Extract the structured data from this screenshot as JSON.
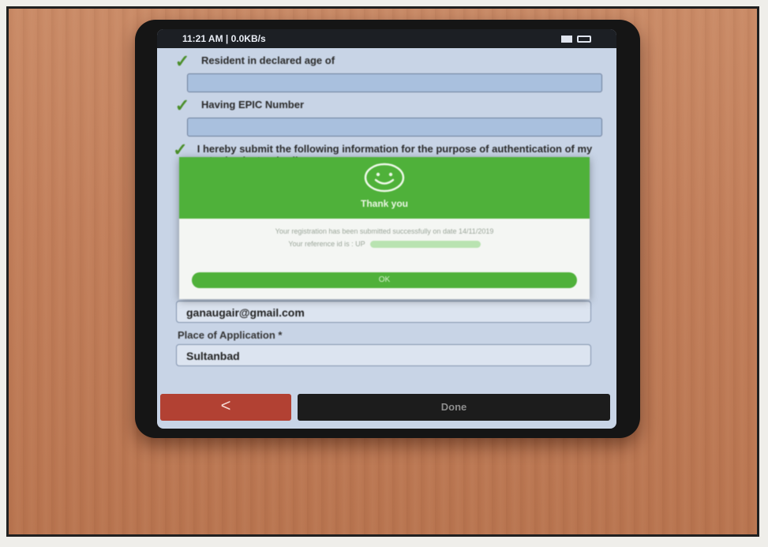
{
  "status_bar": {
    "time": "11:21 AM | 0.0KB/s"
  },
  "form_top": {
    "check_1": "Resident in declared age of",
    "check_2": "Having EPIC Number",
    "check_3": "I hereby submit the following information for the purpose of authentication of my entry in electoral roll"
  },
  "dialog": {
    "title": "Thank you",
    "message": "Your registration has been submitted successfully on date 14/11/2019",
    "reference_label": "Your reference id is : UP",
    "ok_label": "OK"
  },
  "form_bottom": {
    "email_value": "ganaugair@gmail.com",
    "place_label": "Place of Application *",
    "place_value": "Sultanbad"
  },
  "nav": {
    "back_label": "<",
    "done_label": "Done"
  },
  "colors": {
    "accent_green": "#4fb13a",
    "back_red": "#b24133"
  }
}
